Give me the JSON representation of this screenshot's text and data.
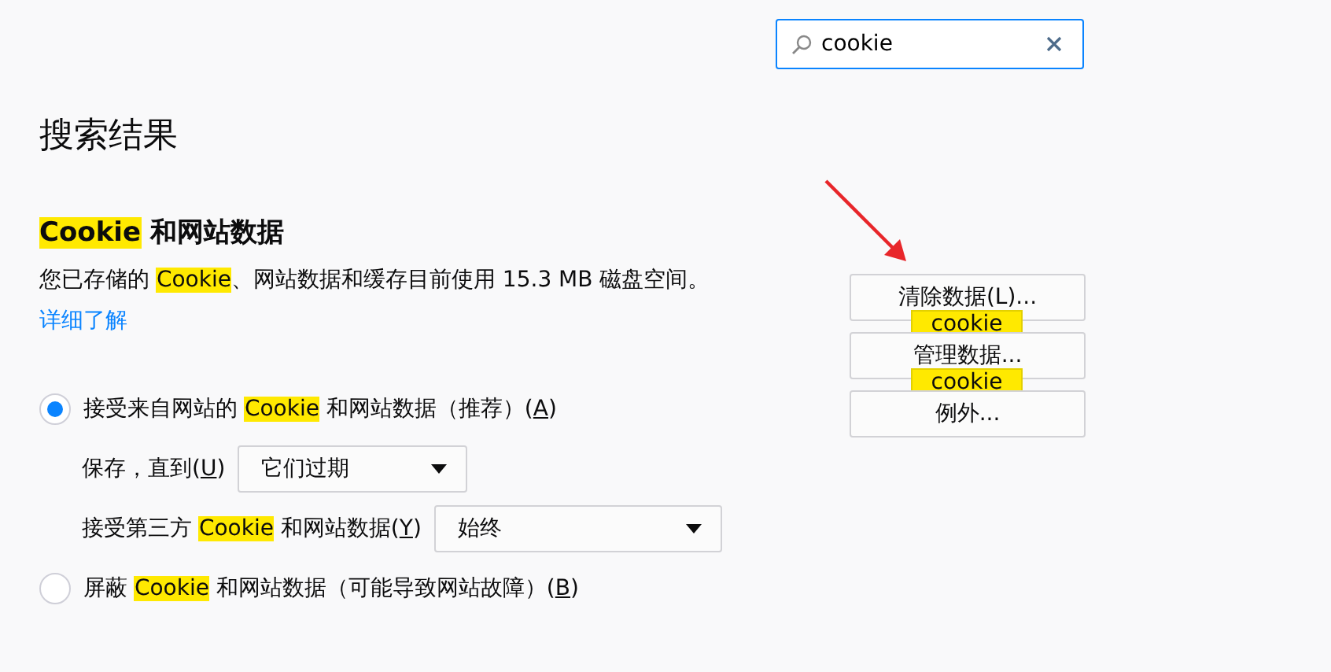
{
  "search": {
    "value": "cookie"
  },
  "page_title": "搜索结果",
  "section": {
    "heading": [
      {
        "text": "Cookie",
        "highlight": true
      },
      {
        "text": " 和网站数据"
      }
    ],
    "description": [
      {
        "text": "您已存储的 "
      },
      {
        "text": "Cookie",
        "highlight": true
      },
      {
        "text": "、网站数据和缓存目前使用 15.3 MB 磁盘空间。"
      }
    ],
    "link": "详细了解",
    "buttons": [
      {
        "label": "清除数据(L)...",
        "tooltip": "cookie"
      },
      {
        "label": "管理数据...",
        "tooltip": "cookie"
      },
      {
        "label": "例外..."
      }
    ],
    "options": [
      {
        "kind": "radio",
        "selected": true,
        "label": [
          {
            "text": "接受来自网站的 "
          },
          {
            "text": "Cookie",
            "highlight": true
          },
          {
            "text": " 和网站数据（推荐）("
          },
          {
            "text": "A",
            "underline": true
          },
          {
            "text": ")"
          }
        ]
      },
      {
        "kind": "select",
        "label": [
          {
            "text": "保存，直到("
          },
          {
            "text": "U",
            "underline": true
          },
          {
            "text": ")"
          }
        ],
        "value": "它们过期"
      },
      {
        "kind": "select",
        "label": [
          {
            "text": "接受第三方 "
          },
          {
            "text": "Cookie",
            "highlight": true
          },
          {
            "text": " 和网站数据("
          },
          {
            "text": "Y",
            "underline": true
          },
          {
            "text": ")"
          }
        ],
        "value": "始终"
      },
      {
        "kind": "radio",
        "selected": false,
        "label": [
          {
            "text": "屏蔽 "
          },
          {
            "text": "Cookie",
            "highlight": true
          },
          {
            "text": " 和网站数据（可能导致网站故障）("
          },
          {
            "text": "B",
            "underline": true
          },
          {
            "text": ")"
          }
        ]
      }
    ]
  }
}
